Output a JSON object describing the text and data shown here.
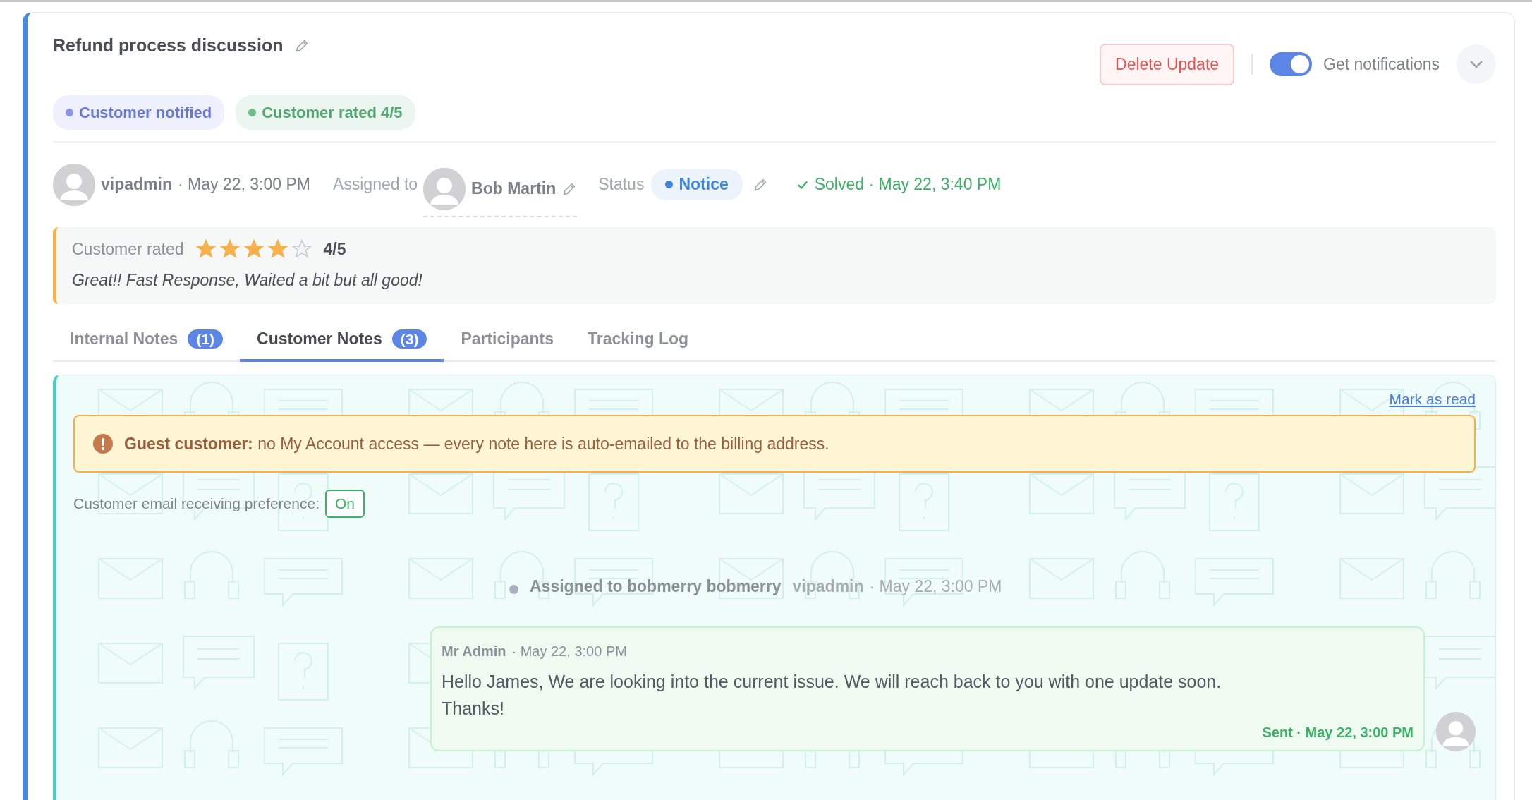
{
  "title": "Refund process discussion",
  "header_actions": {
    "delete_button": "Delete Update",
    "notifications": {
      "label": "Get notifications",
      "on": true
    }
  },
  "badges": [
    {
      "label": "Customer notified",
      "color": "#8a95ee"
    },
    {
      "label": "Customer rated 4/5",
      "color": "#6cbf8a"
    }
  ],
  "meta": {
    "author": "vipadmin",
    "created": "· May 22, 3:00 PM",
    "assigned_label": "Assigned to",
    "assignee": "Bob Martin",
    "status_label": "Status",
    "status": "Notice",
    "resolution": "Solved · May 22, 3:40 PM"
  },
  "rating": {
    "label": "Customer rated",
    "stars": 4,
    "score": "4/5",
    "comment": "Great!! Fast Response, Waited a bit but all good!"
  },
  "tabs": [
    {
      "label": "Internal Notes",
      "count": "(1)",
      "selected": false
    },
    {
      "label": "Customer Notes",
      "count": "(3)",
      "selected": true
    },
    {
      "label": "Participants",
      "selected": false
    },
    {
      "label": "Tracking Log",
      "selected": false
    }
  ],
  "notes": {
    "mark_read": "Mark as read",
    "alert": "**Guest customer:** no My Account access — every note here is auto-emailed to the billing address.",
    "preference_label": "Customer email receiving preference:",
    "preference_value": "On",
    "entries": [
      {
        "kind": "event",
        "text": "Assigned to bobmerry bobmerry",
        "author": "vipadmin",
        "time": "· May 22, 3:00 PM"
      },
      {
        "kind": "message",
        "author": "Mr Admin",
        "time": "· May 22, 3:00 PM",
        "text": "Hello James, We are looking into the current issue. We will reach back to you with one update soon. Thanks!",
        "status": "Sent · May 22, 3:00 PM"
      }
    ]
  }
}
